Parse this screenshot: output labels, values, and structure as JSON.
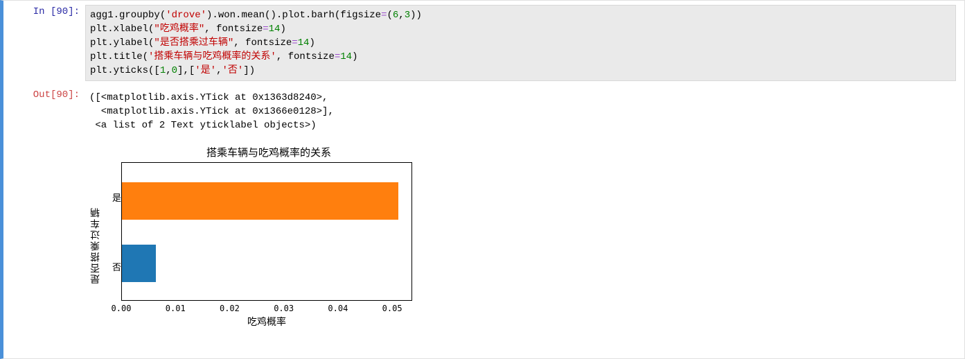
{
  "in_prompt": "In  [90]:",
  "out_prompt": "Out[90]:",
  "code": {
    "l1a": "agg1.groupby(",
    "l1b": "'drove'",
    "l1c": ").won.mean().plot.barh(figsize",
    "l1d": "=",
    "l1e": "(",
    "l1f": "6",
    "l1g": ",",
    "l1h": "3",
    "l1i": "))",
    "l2a": "plt.xlabel(",
    "l2b": "\"吃鸡概率\"",
    "l2c": ", fontsize",
    "l2d": "=",
    "l2e": "14",
    "l2f": ")",
    "l3a": "plt.ylabel(",
    "l3b": "\"是否搭乘过车辆\"",
    "l3c": ", fontsize",
    "l3d": "=",
    "l3e": "14",
    "l3f": ")",
    "l4a": "plt.title(",
    "l4b": "'搭乘车辆与吃鸡概率的关系'",
    "l4c": ", fontsize",
    "l4d": "=",
    "l4e": "14",
    "l4f": ")",
    "l5a": "plt.yticks([",
    "l5b": "1",
    "l5c": ",",
    "l5d": "0",
    "l5e": "],[",
    "l5f": "'是'",
    "l5g": ",",
    "l5h": "'否'",
    "l5i": "])"
  },
  "output": {
    "l1": "([<matplotlib.axis.YTick at 0x1363d8240>,",
    "l2": "  <matplotlib.axis.YTick at 0x1366e0128>],",
    "l3": " <a list of 2 Text yticklabel objects>)"
  },
  "chart_data": {
    "type": "bar",
    "orientation": "horizontal",
    "title": "搭乘车辆与吃鸡概率的关系",
    "xlabel": "吃鸡概率",
    "ylabel": "是否搭乘过车辆",
    "categories": [
      "是",
      "否"
    ],
    "values": [
      0.057,
      0.007
    ],
    "xlim": [
      0.0,
      0.06
    ],
    "xticks": [
      "0.00",
      "0.01",
      "0.02",
      "0.03",
      "0.04",
      "0.05"
    ],
    "colors": [
      "#ff7f0e",
      "#1f77b4"
    ]
  }
}
